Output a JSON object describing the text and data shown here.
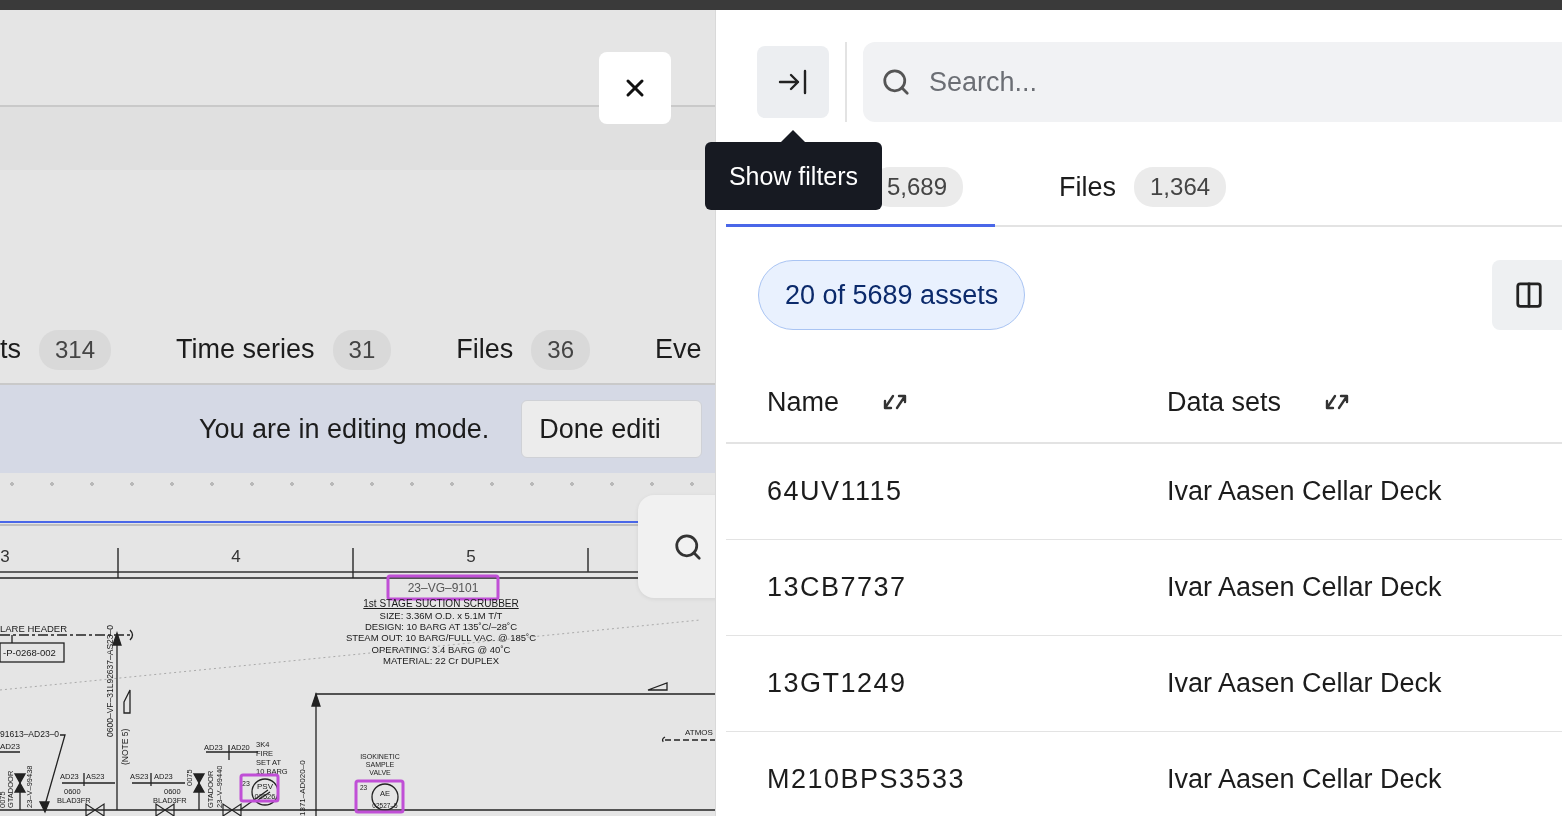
{
  "background_tabs": [
    {
      "label": "ts",
      "count": "314"
    },
    {
      "label": "Time series",
      "count": "31"
    },
    {
      "label": "Files",
      "count": "36"
    },
    {
      "label": "Eve"
    }
  ],
  "edit_banner": {
    "message": "You are in editing mode.",
    "button": "Done editi"
  },
  "ruler": {
    "marks": [
      "3",
      "4",
      "5"
    ]
  },
  "diagram": {
    "labels": [
      {
        "text": "23–VG–9101",
        "highlighted": true
      },
      {
        "text": "1st STAGE SUCTION SCRUBBER",
        "highlighted": false
      },
      {
        "text": "SIZE: 3.36M O.D. x 5.1M T/T",
        "highlighted": false
      },
      {
        "text": "DESIGN: 10 BARG AT 135˚C/–28˚C",
        "highlighted": false
      },
      {
        "text": "STEAM OUT: 10 BARG/FULL VAC. @ 185˚C",
        "highlighted": false
      },
      {
        "text": "OPERATING: 3.4 BARG @ 40˚C",
        "highlighted": false
      },
      {
        "text": "MATERIAL:  22 Cr DUPLEX",
        "highlighted": false
      },
      {
        "text": "LARE HEADER",
        "highlighted": false
      },
      {
        "text": "-P-0268-002",
        "highlighted": false
      },
      {
        "text": "0600–VF–31L92637–AS23–0",
        "highlighted": false
      },
      {
        "text": "(NOTE 5)",
        "highlighted": false
      },
      {
        "text": "91613–AD23–0",
        "highlighted": false
      },
      {
        "text": "AD23",
        "highlighted": false
      },
      {
        "text": "0075",
        "highlighted": false
      },
      {
        "text": "GTADOOR",
        "highlighted": false
      },
      {
        "text": "23–V–99438",
        "highlighted": false
      },
      {
        "text": "AD23",
        "highlighted": false
      },
      {
        "text": "AS23",
        "highlighted": false
      },
      {
        "text": "0600",
        "highlighted": false
      },
      {
        "text": "BLAD3FR",
        "highlighted": false
      },
      {
        "text": "AS23",
        "highlighted": false
      },
      {
        "text": "AD23",
        "highlighted": false
      },
      {
        "text": "0600",
        "highlighted": false
      },
      {
        "text": "BLAD3FR",
        "highlighted": false
      },
      {
        "text": "0075",
        "highlighted": false
      },
      {
        "text": "GTADOOR",
        "highlighted": false
      },
      {
        "text": "23–V–99440",
        "highlighted": false
      },
      {
        "text": "AD23",
        "highlighted": false
      },
      {
        "text": "AD20",
        "highlighted": false
      },
      {
        "text": "3K4",
        "highlighted": false
      },
      {
        "text": "FIRE",
        "highlighted": false
      },
      {
        "text": "SET AT",
        "highlighted": false
      },
      {
        "text": "10 BARG",
        "highlighted": false
      },
      {
        "text": "23",
        "highlighted": false
      },
      {
        "text": "PSV",
        "highlighted": true
      },
      {
        "text": "02526",
        "highlighted": false
      },
      {
        "text": "1371–AD020–0",
        "highlighted": false
      },
      {
        "text": "ISOKINETIC",
        "highlighted": false
      },
      {
        "text": "SAMPLE",
        "highlighted": false
      },
      {
        "text": "VALVE",
        "highlighted": false
      },
      {
        "text": "23",
        "highlighted": false
      },
      {
        "text": "AE",
        "highlighted": true
      },
      {
        "text": "02527–5",
        "highlighted": false
      },
      {
        "text": "ATMOS",
        "highlighted": false
      }
    ]
  },
  "search": {
    "placeholder": "Search..."
  },
  "tooltip": "Show filters",
  "tabs": [
    {
      "count": "5,689",
      "selected": true
    },
    {
      "label": "Files",
      "count": "1,364",
      "selected": false
    }
  ],
  "result_chip": "20 of 5689 assets",
  "table": {
    "columns": [
      {
        "label": "Name"
      },
      {
        "label": "Data sets"
      }
    ],
    "rows": [
      {
        "name": "64UV1115",
        "data_set": "Ivar Aasen Cellar Deck"
      },
      {
        "name": "13CB7737",
        "data_set": "Ivar Aasen Cellar Deck"
      },
      {
        "name": "13GT1249",
        "data_set": "Ivar Aasen Cellar Deck"
      },
      {
        "name": "M210BPS3533",
        "data_set": "Ivar Aasen Cellar Deck"
      }
    ]
  }
}
